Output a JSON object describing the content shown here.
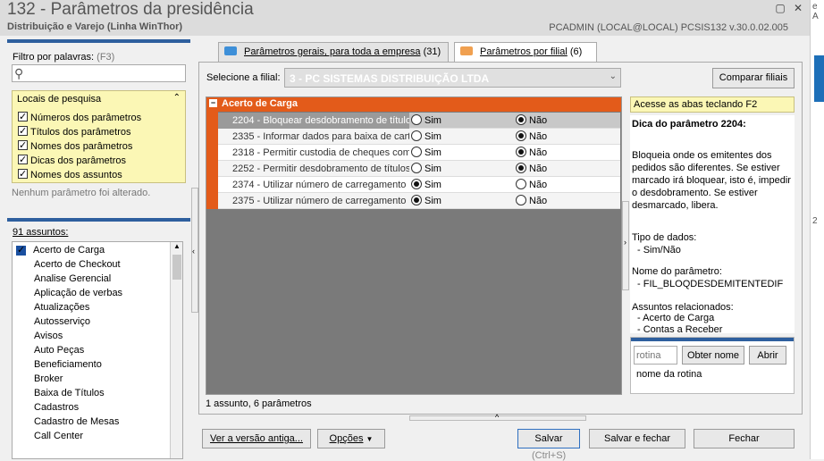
{
  "window": {
    "title": "132 - Parâmetros da presidência",
    "subtitle": "Distribuição e Varejo (Linha WinThor)",
    "right_info": "PCADMIN (LOCAL@LOCAL)   PCSIS132  v.30.0.02.005"
  },
  "ext_text": [
    "e A",
    "2"
  ],
  "filter": {
    "label": "Filtro por palavras:",
    "shortcut": "(F3)",
    "value": "",
    "locais_title": "Locais de pesquisa",
    "options": [
      {
        "label": "Números dos parâmetros",
        "checked": true
      },
      {
        "label": "Títulos dos parâmetros",
        "checked": true
      },
      {
        "label": "Nomes dos parâmetros",
        "checked": true
      },
      {
        "label": "Dicas dos parâmetros",
        "checked": true
      },
      {
        "label": "Nomes dos assuntos",
        "checked": true
      }
    ],
    "status": "Nenhum parâmetro foi alterado."
  },
  "subjects": {
    "count_label": "91 assuntos:",
    "items": [
      "Acerto de Carga",
      "Acerto de Checkout",
      "Analise Gerencial",
      "Aplicação de verbas",
      "Atualizações",
      "Autosserviço",
      "Avisos",
      "Auto Peças",
      "Beneficiamento",
      "Broker",
      "Baixa de Títulos",
      "Cadastros",
      "Cadastro de Mesas",
      "Call Center"
    ]
  },
  "tabs": [
    {
      "label": "Parâmetros gerais, para toda a empresa",
      "count": "(31)",
      "active": false
    },
    {
      "label": "Parâmetros por filial",
      "count": "(6)",
      "active": true
    }
  ],
  "filial": {
    "label": "Selecione a filial:",
    "value": "3 - PC SISTEMAS DISTRIBUIÇÃO LTDA",
    "compare_button": "Comparar filiais"
  },
  "group": {
    "title": "Acerto de Carga",
    "rows": [
      {
        "label": "2204 - Bloquear desdobramento de títulos",
        "sim": "Sim",
        "nao": "Não",
        "selected": "nao"
      },
      {
        "label": "2335 - Informar dados para baixa de cartão",
        "sim": "Sim",
        "nao": "Não",
        "selected": "nao"
      },
      {
        "label": "2318 - Permitir custodia de cheques com",
        "sim": "Sim",
        "nao": "Não",
        "selected": "nao"
      },
      {
        "label": "2252 - Permitir desdobramento de títulos",
        "sim": "Sim",
        "nao": "Não",
        "selected": "nao"
      },
      {
        "label": "2374 - Utilizar número de carregamento a",
        "sim": "Sim",
        "nao": "Não",
        "selected": "sim"
      },
      {
        "label": "2375 - Utilizar número de carregamento a",
        "sim": "Sim",
        "nao": "Não",
        "selected": "sim"
      }
    ],
    "status": "1 assunto, 6 parâmetros"
  },
  "hint": {
    "access": "Acesse as abas teclando F2",
    "title": "Dica do parâmetro 2204:",
    "body": "Bloqueia onde os emitentes dos pedidos são diferentes. Se estiver marcado irá bloquear, isto é, impedir o desdobramento. Se estiver desmarcado, libera.",
    "type_label": "Tipo de dados:",
    "type_value": "- Sim/Não",
    "name_label": "Nome do parâmetro:",
    "name_value": "- FIL_BLOQDESDEMITENTEDIF",
    "related_label": "Assuntos relacionados:",
    "related": [
      "- Acerto de Carga",
      "- Contas a Receber"
    ]
  },
  "rotina": {
    "placeholder": "rotina",
    "get_name_button": "Obter nome",
    "open_button": "Abrir",
    "name_label": "nome da rotina"
  },
  "footer": {
    "old_version_button": "Ver a versão antiga...",
    "options_button": "Opções",
    "save_button": "Salvar",
    "save_shortcut": "(Ctrl+S)",
    "save_close_button": "Salvar e fechar",
    "close_button": "Fechar"
  },
  "colors": {
    "accent_orange": "#e35b1a",
    "blue_bar": "#2e5f9e",
    "highlight_yellow": "#fbf7b5"
  }
}
